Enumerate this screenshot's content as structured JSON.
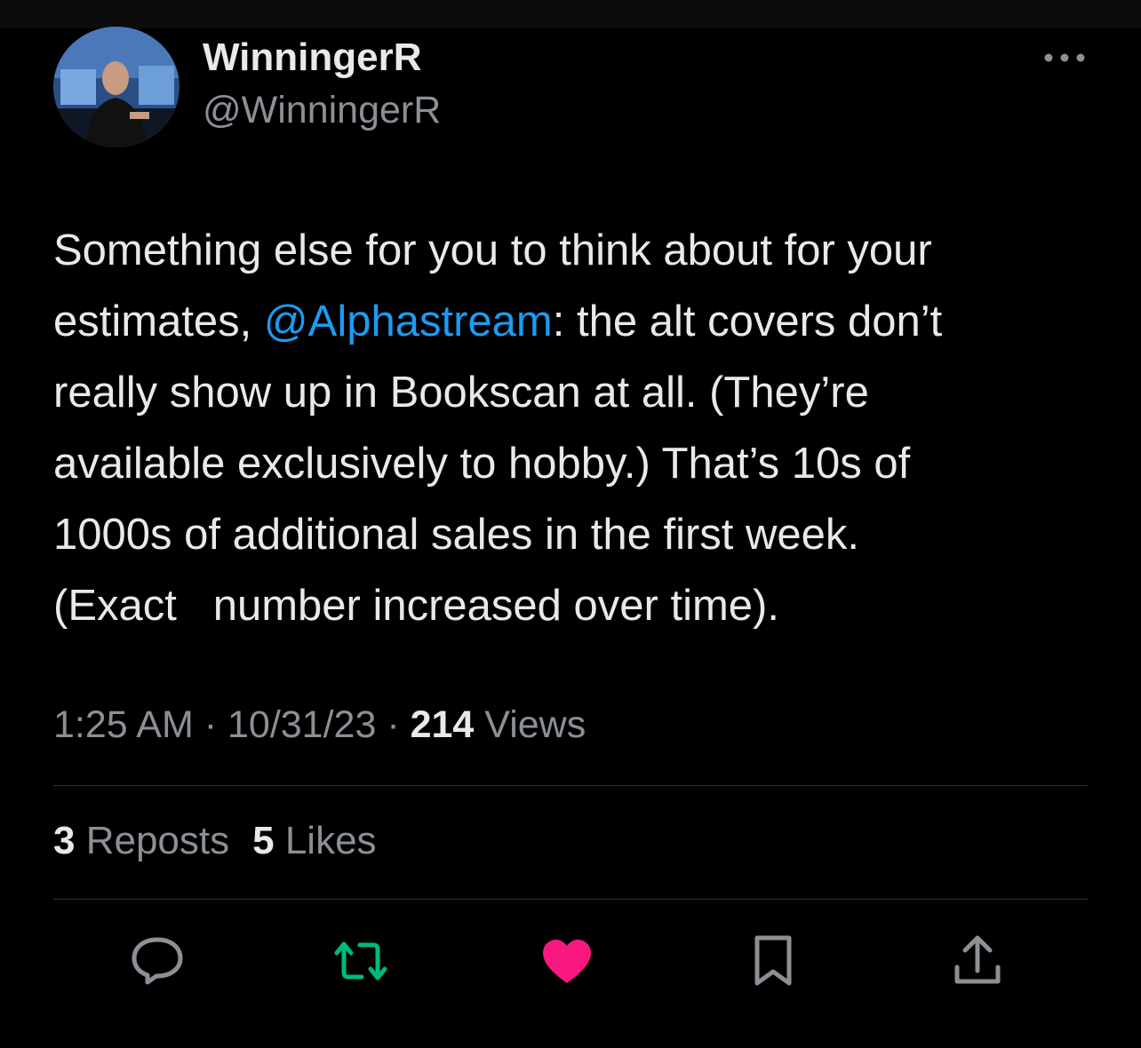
{
  "user": {
    "display_name": "WinningerR",
    "handle": "@WinningerR",
    "avatar_icon": "avatar-photo"
  },
  "tweet": {
    "text_1": "Something else for you to think about for your\nestimates, ",
    "mention": "@Alphastream",
    "text_2": ": the alt covers don’t\nreally show up in Bookscan at all. (They’re\navailable exclusively to hobby.) That’s 10s of\n1000s of additional sales in the first week.\n(Exact   number increased over time)."
  },
  "meta": {
    "time": "1:25 AM",
    "sep1": " · ",
    "date": "10/31/23",
    "sep2": " · ",
    "views_count": "214",
    "views_label": " Views"
  },
  "stats": {
    "reposts_count": "3",
    "reposts_label": " Reposts",
    "likes_count": "5",
    "likes_label": " Likes"
  },
  "actions": {
    "reply_icon": "speech-bubble-icon",
    "repost_icon": "repost-arrows-icon",
    "like_icon": "heart-icon",
    "bookmark_icon": "bookmark-icon",
    "share_icon": "share-upload-icon"
  },
  "colors": {
    "background": "#000000",
    "text_primary": "#e7e9ea",
    "text_secondary": "#8b9096",
    "mention": "#1d9bf0",
    "repost_active": "#00ba7c",
    "like_active": "#f91880",
    "divider": "#2f3336"
  }
}
